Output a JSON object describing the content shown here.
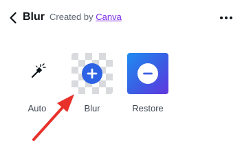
{
  "header": {
    "title": "Blur",
    "created_prefix": "Created by",
    "creator_link": "Canva",
    "back_icon": "chevron-left-icon",
    "more_icon": "more-horizontal-icon"
  },
  "tools": [
    {
      "label": "Auto",
      "icon": "magic-wand-icon"
    },
    {
      "label": "Blur",
      "icon": "plus-circle-icon"
    },
    {
      "label": "Restore",
      "icon": "minus-circle-icon"
    }
  ],
  "colors": {
    "accent_link": "#7d2ae8",
    "blur_button": "#2d62e4",
    "restore_gradient_start": "#1f8cf0",
    "restore_gradient_end": "#6236df",
    "annotation_arrow": "#e8312a"
  }
}
